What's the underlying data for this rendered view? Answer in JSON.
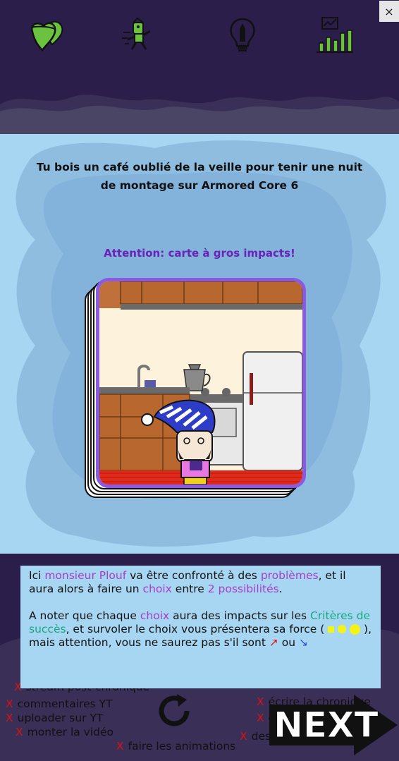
{
  "header": {
    "close_label": "×",
    "stats": [
      {
        "name": "hearts-icon",
        "color": "#6bc23e"
      },
      {
        "name": "runner-icon",
        "color": "#6bc23e"
      },
      {
        "name": "lightbulb-icon",
        "color": "#111111"
      },
      {
        "name": "growth-chart-icon",
        "color": "#6bc23e"
      }
    ]
  },
  "card": {
    "prompt": "Tu bois un café oublié de la veille pour tenir une nuit de montage sur Armored Core 6",
    "warning": "Attention: carte à gros impacts!"
  },
  "tutorial": {
    "p1": {
      "t1": "Ici ",
      "h1": "monsieur Plouf",
      "t2": " va être confronté à des ",
      "h2": "problèmes",
      "t3": ", et il aura alors à faire un ",
      "h3": "choix",
      "t4": " entre ",
      "h4": "2 possibilités",
      "t5": "."
    },
    "p2": {
      "t1": "A noter que chaque ",
      "h1": "choix",
      "t2": " aura des impacts sur les ",
      "h2": "Critères de succès",
      "t3": ", et survoler le choix vous présentera sa force (",
      "t4": " ), mais attention, vous ne saurez pas s'il sont ",
      "up": "↗",
      "t5": " ou ",
      "down": "↘"
    }
  },
  "tasks": {
    "mark": "X",
    "left": [
      "stream post-chronique",
      "commentaires YT",
      "uploader sur YT",
      "monter la vidéo"
    ],
    "center": "faire les animations",
    "right": [
      "écrire la chronique",
      "é",
      "des"
    ]
  },
  "next_label": "NEXT",
  "colors": {
    "header_bg": "#2b1e4a",
    "main_bg": "#a7d6f2",
    "accent_purple": "#8a5ae0",
    "warning": "#6a22b8",
    "highlight_purple": "#a63ec8",
    "highlight_teal": "#17a87e"
  }
}
